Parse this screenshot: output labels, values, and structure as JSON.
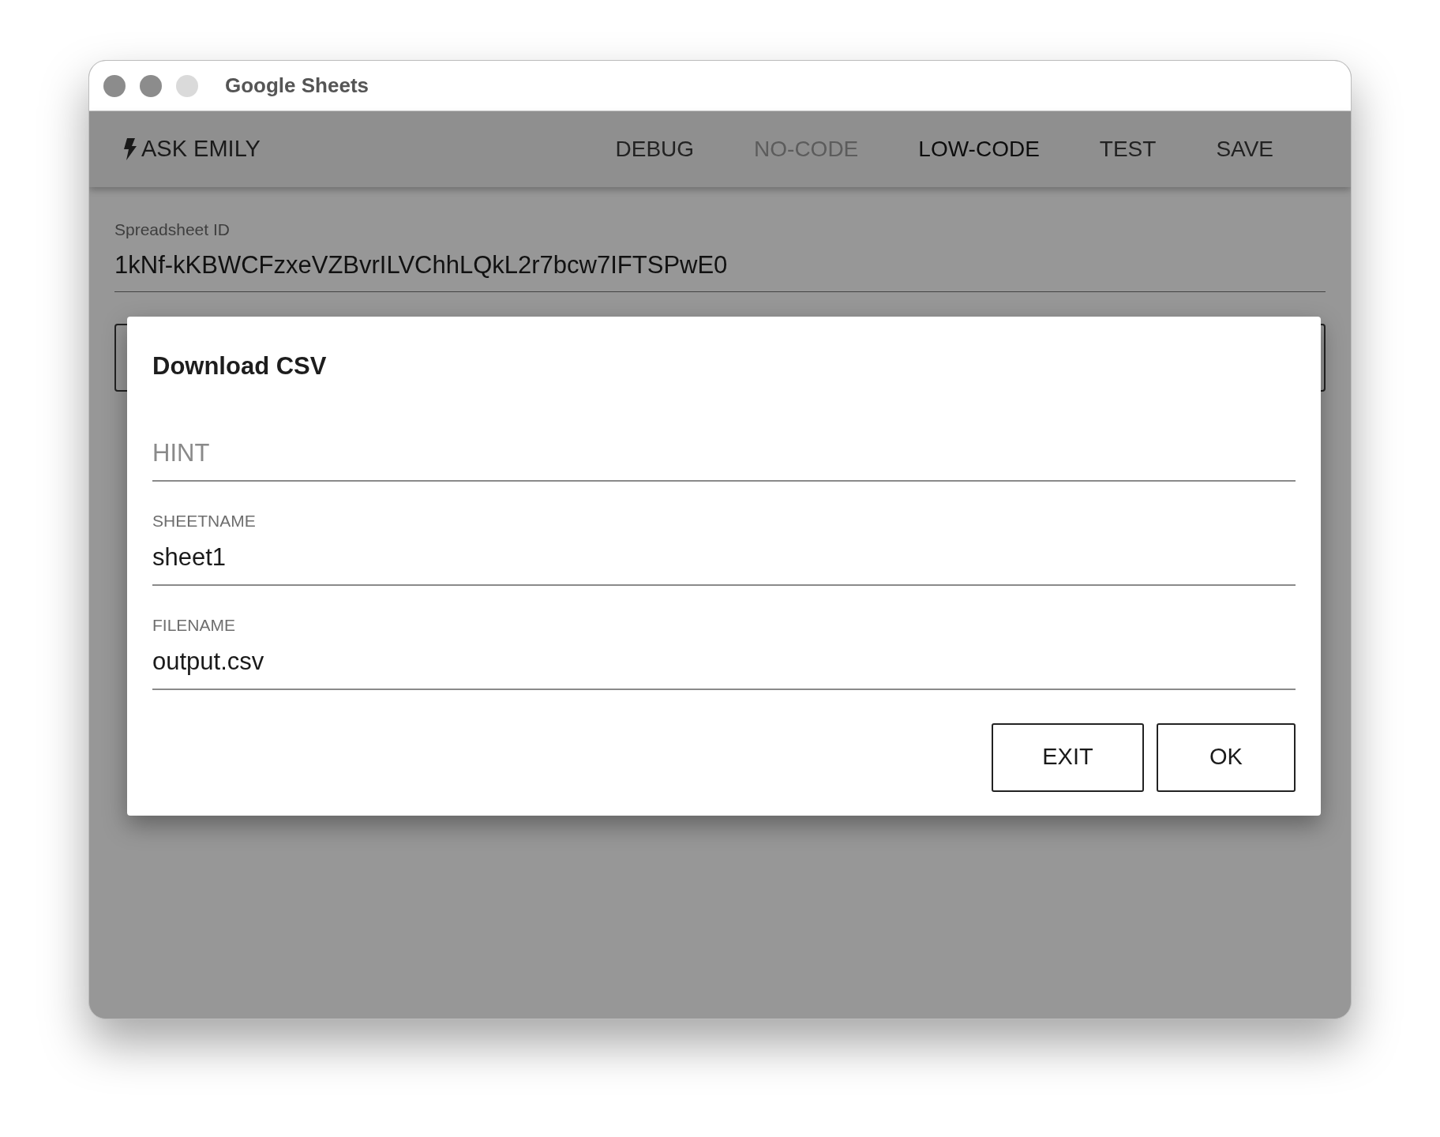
{
  "window": {
    "title": "Google Sheets"
  },
  "toolbar": {
    "ask_button": {
      "label": "ASK EMILY"
    },
    "items": [
      {
        "label": "DEBUG",
        "kind": "action"
      },
      {
        "label": "NO-CODE",
        "kind": "mode",
        "selected": false
      },
      {
        "label": "LOW-CODE",
        "kind": "mode",
        "selected": true
      },
      {
        "label": "TEST",
        "kind": "action"
      },
      {
        "label": "SAVE",
        "kind": "action"
      }
    ]
  },
  "spreadsheet_field": {
    "label": "Spreadsheet ID",
    "value": "1kNf-kKBWCFzxeVZBvrILVChhLQkL2r7bcw7IFTSPwE0"
  },
  "dialog": {
    "title": "Download CSV",
    "fields": [
      {
        "placeholder": "HINT"
      },
      {
        "label": "SHEETNAME",
        "value": "sheet1"
      },
      {
        "label": "FILENAME",
        "value": "output.csv"
      }
    ],
    "buttons": [
      "EXIT",
      "OK"
    ]
  }
}
